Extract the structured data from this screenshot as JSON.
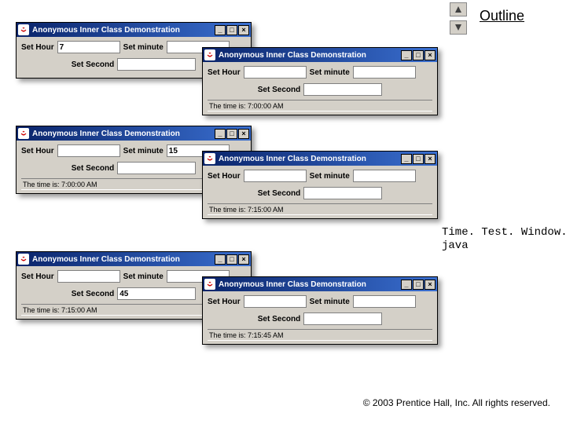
{
  "outline": "Outline",
  "filename": "Time. Test. Window.\njava",
  "copyright": "© 2003 Prentice Hall, Inc.\nAll rights reserved.",
  "labels": {
    "hour": "Set Hour",
    "minute": "Set minute",
    "second": "Set Second"
  },
  "title": "Anonymous Inner Class Demonstration",
  "ctrl": {
    "min": "_",
    "max": "□",
    "close": "×"
  },
  "windows": {
    "w1": {
      "hour": "7",
      "minute": "",
      "second": "",
      "status": ""
    },
    "w2": {
      "hour": "",
      "minute": "",
      "second": "",
      "status": "The time is: 7:00:00 AM"
    },
    "w3": {
      "hour": "",
      "minute": "15",
      "second": "",
      "status": "The time is: 7:00:00 AM"
    },
    "w4": {
      "hour": "",
      "minute": "",
      "second": "",
      "status": "The time is: 7:15:00 AM"
    },
    "w5": {
      "hour": "",
      "minute": "",
      "second": "45",
      "status": "The time is: 7:15:00 AM"
    },
    "w6": {
      "hour": "",
      "minute": "",
      "second": "",
      "status": "The time is: 7:15:45 AM"
    }
  }
}
